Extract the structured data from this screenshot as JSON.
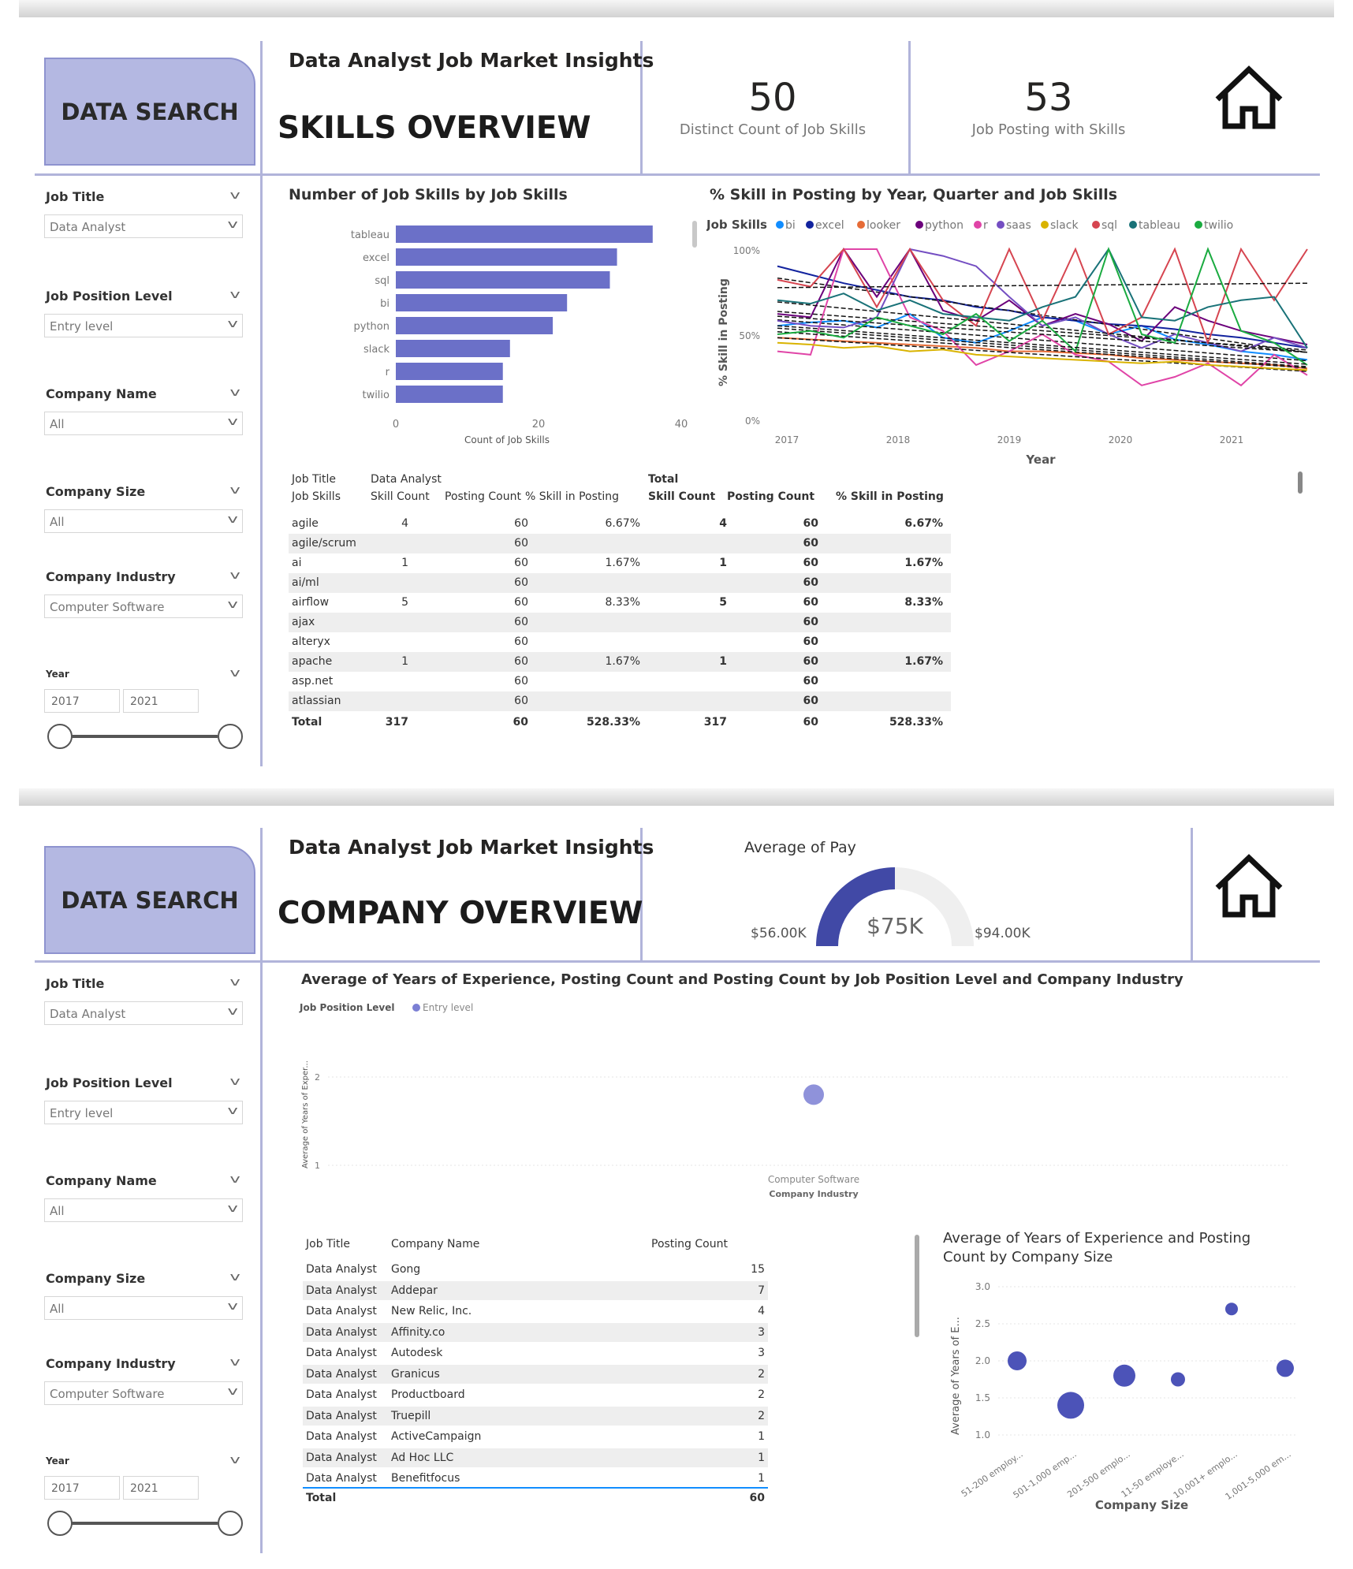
{
  "common": {
    "data_search_label": "DATA SEARCH",
    "report_title": "Data Analyst Job Market Insights",
    "filters": {
      "job_title": {
        "label": "Job Title",
        "value": "Data Analyst"
      },
      "job_position_level": {
        "label": "Job Position Level",
        "value": "Entry level"
      },
      "company_name": {
        "label": "Company Name",
        "value": "All"
      },
      "company_size": {
        "label": "Company Size",
        "value": "All"
      },
      "company_industry": {
        "label": "Company Industry",
        "value": "Computer Software"
      },
      "year": {
        "label": "Year",
        "from": "2017",
        "to": "2021"
      }
    }
  },
  "page1": {
    "heading": "SKILLS OVERVIEW",
    "kpis": [
      {
        "value": "50",
        "label": "Distinct Count of Job Skills"
      },
      {
        "value": "53",
        "label": "Job Posting with Skills"
      }
    ],
    "bar_title": "Number of Job Skills by Job Skills",
    "line_title": "% Skill in Posting by Year, Quarter and Job Skills",
    "table": {
      "header1": [
        "Job Title",
        "Data Analyst",
        "Total"
      ],
      "header2": [
        "Job Skills",
        "Skill Count",
        "Posting Count",
        "% Skill in Posting",
        "Skill Count",
        "Posting Count",
        "% Skill in Posting"
      ],
      "rows": [
        [
          "agile",
          "4",
          "60",
          "6.67%",
          "4",
          "60",
          "6.67%"
        ],
        [
          "agile/scrum",
          "",
          "60",
          "",
          "",
          "60",
          ""
        ],
        [
          "ai",
          "1",
          "60",
          "1.67%",
          "1",
          "60",
          "1.67%"
        ],
        [
          "ai/ml",
          "",
          "60",
          "",
          "",
          "60",
          ""
        ],
        [
          "airflow",
          "5",
          "60",
          "8.33%",
          "5",
          "60",
          "8.33%"
        ],
        [
          "ajax",
          "",
          "60",
          "",
          "",
          "60",
          ""
        ],
        [
          "alteryx",
          "",
          "60",
          "",
          "",
          "60",
          ""
        ],
        [
          "apache",
          "1",
          "60",
          "1.67%",
          "1",
          "60",
          "1.67%"
        ],
        [
          "asp.net",
          "",
          "60",
          "",
          "",
          "60",
          ""
        ],
        [
          "atlassian",
          "",
          "60",
          "",
          "",
          "60",
          ""
        ]
      ],
      "total": [
        "Total",
        "317",
        "60",
        "528.33%",
        "317",
        "60",
        "528.33%"
      ]
    }
  },
  "page2": {
    "heading": "COMPANY OVERVIEW",
    "gauge": {
      "title": "Average of Pay",
      "value_label": "$75K",
      "min_label": "$56.00K",
      "max_label": "$94.00K",
      "min": 56,
      "max": 94,
      "value": 75
    },
    "scatter_title": "Average of Years of Experience, Posting Count and Posting Count by Job Position Level and Company Industry",
    "company_table": {
      "headers": [
        "Job Title",
        "Company Name",
        "Posting Count"
      ],
      "rows": [
        [
          "Data Analyst",
          "Gong",
          "15"
        ],
        [
          "Data Analyst",
          "Addepar",
          "7"
        ],
        [
          "Data Analyst",
          "New Relic, Inc.",
          "4"
        ],
        [
          "Data Analyst",
          "Affinity.co",
          "3"
        ],
        [
          "Data Analyst",
          "Autodesk",
          "3"
        ],
        [
          "Data Analyst",
          "Granicus",
          "2"
        ],
        [
          "Data Analyst",
          "Productboard",
          "2"
        ],
        [
          "Data Analyst",
          "Truepill",
          "2"
        ],
        [
          "Data Analyst",
          "ActiveCampaign",
          "1"
        ],
        [
          "Data Analyst",
          "Ad Hoc LLC",
          "1"
        ],
        [
          "Data Analyst",
          "Benefitfocus",
          "1"
        ]
      ],
      "total": [
        "Total",
        "",
        "60"
      ]
    },
    "size_title_line1": "Average of Years of Experience and Posting",
    "size_title_line2": "Count by Company Size"
  },
  "chart_data": [
    {
      "type": "bar",
      "title": "Number of Job Skills by Job Skills",
      "categories": [
        "tableau",
        "excel",
        "sql",
        "bi",
        "python",
        "slack",
        "r",
        "twilio"
      ],
      "values": [
        36,
        31,
        30,
        24,
        22,
        16,
        15,
        15
      ],
      "xlabel": "Count of Job Skills",
      "xlim": [
        0,
        40
      ],
      "xticks": [
        "0",
        "20",
        "40"
      ]
    },
    {
      "type": "line",
      "title": "% Skill in Posting by Year, Quarter and Job Skills",
      "xlabel": "Year",
      "ylabel": "% Skill in Posting",
      "yticks": [
        "100%",
        "50%",
        "0%"
      ],
      "xticks": [
        "2017",
        "2018",
        "2019",
        "2020",
        "2021"
      ],
      "legend_title": "Job Skills",
      "legend_position": "top",
      "series": [
        {
          "name": "bi",
          "color": "#118DFF",
          "values": [
            55,
            57,
            58,
            54,
            62,
            48,
            45,
            52,
            60,
            58,
            50,
            55,
            47,
            44,
            40,
            38,
            35
          ]
        },
        {
          "name": "excel",
          "color": "#12239E",
          "values": [
            90,
            85,
            80,
            76,
            72,
            70,
            66,
            64,
            60,
            58,
            56,
            55,
            53,
            50,
            48,
            45,
            42
          ]
        },
        {
          "name": "looker",
          "color": "#E66C37",
          "values": [
            48,
            47,
            46,
            45,
            44,
            43,
            42,
            40,
            40,
            39,
            38,
            36,
            35,
            34,
            33,
            32,
            30
          ]
        },
        {
          "name": "python",
          "color": "#6B007B",
          "values": [
            62,
            60,
            100,
            72,
            100,
            64,
            58,
            70,
            55,
            62,
            56,
            46,
            66,
            58,
            52,
            48,
            44
          ]
        },
        {
          "name": "r",
          "color": "#E044A7",
          "values": [
            40,
            38,
            100,
            100,
            60,
            52,
            32,
            40,
            50,
            38,
            34,
            20,
            25,
            33,
            20,
            38,
            26
          ]
        },
        {
          "name": "saas",
          "color": "#744EC2",
          "values": [
            58,
            55,
            54,
            60,
            100,
            96,
            90,
            72,
            55,
            60,
            50,
            42,
            50,
            45,
            40,
            48,
            42
          ]
        },
        {
          "name": "slack",
          "color": "#D9B300",
          "values": [
            45,
            44,
            42,
            43,
            40,
            41,
            38,
            37,
            36,
            35,
            34,
            33,
            34,
            32,
            31,
            30,
            29
          ]
        },
        {
          "name": "sql",
          "color": "#D64550",
          "values": [
            82,
            78,
            100,
            66,
            100,
            70,
            55,
            100,
            58,
            100,
            50,
            60,
            100,
            45,
            100,
            70,
            100
          ]
        },
        {
          "name": "tableau",
          "color": "#197278",
          "values": [
            70,
            68,
            74,
            64,
            70,
            62,
            60,
            58,
            66,
            72,
            100,
            60,
            58,
            66,
            70,
            72,
            42
          ]
        },
        {
          "name": "twilio",
          "color": "#1AAB40",
          "values": [
            50,
            52,
            48,
            60,
            55,
            50,
            62,
            46,
            58,
            40,
            100,
            50,
            45,
            100,
            52,
            45,
            32
          ]
        }
      ]
    },
    {
      "type": "scatter",
      "title": "Average of Years of Experience, Posting Count and Posting Count by Job Position Level and Company Industry",
      "legend_title": "Job Position Level",
      "series": [
        {
          "name": "Entry level",
          "color": "#7B7FD4",
          "points": [
            {
              "x": "Computer Software",
              "y": 1.8
            }
          ]
        }
      ],
      "xlabel": "Company Industry",
      "ylabel": "Average of Years of Exper...",
      "yticks": [
        "2",
        "1"
      ]
    },
    {
      "type": "scatter",
      "title": "Average of Years of Experience and Posting Count by Company Size",
      "xlabel": "Company Size",
      "ylabel": "Average of Years of E...",
      "categories": [
        "51-200 employ...",
        "501-1,000 emp...",
        "201-500 emplo...",
        "11-50 employe...",
        "10,001+ emplo...",
        "1,001-5,000 em..."
      ],
      "values": [
        2.0,
        1.4,
        1.8,
        1.75,
        2.7,
        1.9
      ],
      "sizes": [
        18,
        28,
        22,
        12,
        10,
        16
      ],
      "yticks": [
        "3.0",
        "2.5",
        "2.0",
        "1.5",
        "1.0"
      ],
      "ylim": [
        1.0,
        3.0
      ]
    }
  ]
}
